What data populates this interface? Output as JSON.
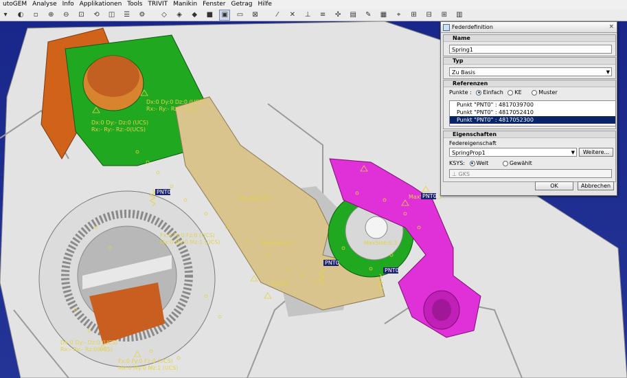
{
  "menubar": {
    "items": [
      "utoGEM",
      "Analyse",
      "Info",
      "Applikationen",
      "Tools",
      "TRIVIT",
      "Manikin",
      "Fenster",
      "Getrag",
      "Hilfe"
    ]
  },
  "viewport": {
    "annotations": [
      "Dx:0 Dy:0 Dz:0 (UCS)",
      "Rx:- Ry:- Rz:- (UCS)",
      "Dx:0 Dy:- Dz:0 (UCS)",
      "Rx:- Ry:- Rz:-0(UCS)",
      "MaxSize:0,3",
      "MaxSize:0,3",
      "MaxSize:0,3",
      "MaxSize:0,3",
      "Fx:0 Fy:0 Fz:0 (UCS)",
      "Mx:0 My:0 Mz:1 (UCS)",
      "Dz:0,3",
      "Dx:0 Dy:- Dz:0 (UCS)",
      "Rx:- Ry:- Rz:0(UCS)",
      "Fx:0 Fy:0 Fz:0 (UCS)",
      "Mx:0 My:0 Mz:1 (UCS)"
    ],
    "points": [
      "PNT0",
      "PNT0",
      "PNT0",
      "PNT0"
    ]
  },
  "dialog": {
    "title": "Federdefinition",
    "close_glyph": "×",
    "name_section": "Name",
    "name_value": "Spring1",
    "typ_section": "Typ",
    "typ_value": "Zu Basis",
    "ref_section": "Referenzen",
    "punkte_label": "Punkte :",
    "opt_einfach": "Einfach",
    "opt_ke": "KE",
    "opt_muster": "Muster",
    "ref_items": [
      "Punkt \"PNT0\" : 4817039700",
      "Punkt \"PNT0\" : 4817052410",
      "Punkt \"PNT0\" : 4817052300"
    ],
    "eig_section": "Eigenschaften",
    "federeig_label": "Federeigenschaft",
    "federeig_value": "SpringProp1",
    "weitere_label": "Weitere...",
    "ksys_label": "KSYS:",
    "opt_welt": "Welt",
    "opt_gewaehlt": "Gewählt",
    "gks_value": "GKS",
    "ok_label": "OK",
    "abbrechen_label": "Abbrechen"
  },
  "colors": {
    "background": "#1a2a8a",
    "housing": "#e6e6e6",
    "orange": "#d1621a",
    "green": "#1fa81f",
    "tan": "#d6c08a",
    "magenta": "#e02ed8",
    "annotation": "#e2d24a",
    "selection": "#0a246a"
  }
}
